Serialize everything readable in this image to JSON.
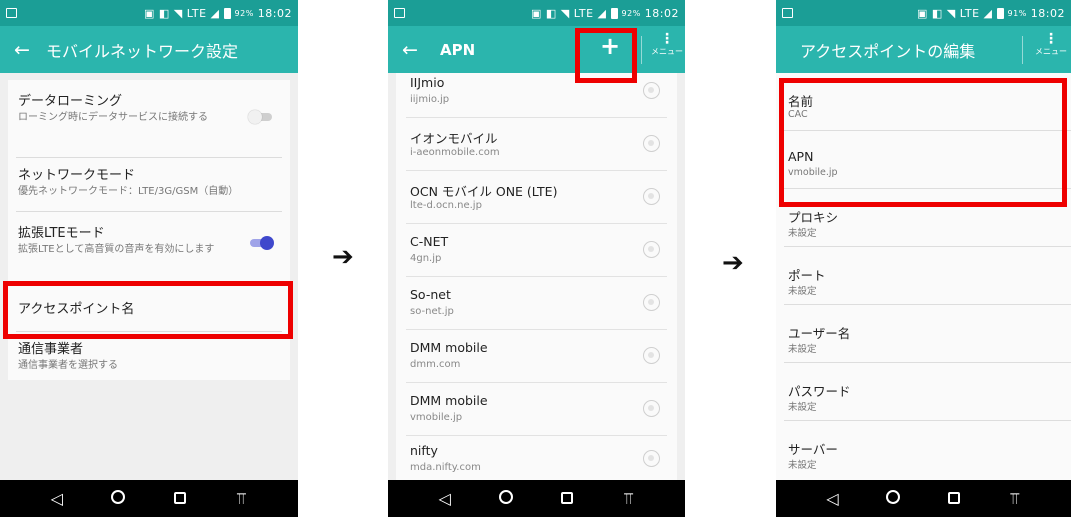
{
  "statusbar": {
    "screen1": {
      "battery": "92%",
      "time": "18:02"
    },
    "screen2": {
      "battery": "92%",
      "time": "18:02"
    },
    "screen3": {
      "battery": "91%",
      "time": "18:02"
    }
  },
  "screen1": {
    "title": "モバイルネットワーク設定",
    "items": [
      {
        "title": "データローミング",
        "summary": "ローミング時にデータサービスに接続する",
        "toggle": "off"
      },
      {
        "title": "ネットワークモード",
        "summary": "優先ネットワークモード：LTE/3G/GSM（自動）"
      },
      {
        "title": "拡張LTEモード",
        "summary": "拡張LTEとして高音質の音声を有効にします",
        "toggle": "on"
      },
      {
        "title": "アクセスポイント名",
        "summary": ""
      },
      {
        "title": "通信事業者",
        "summary": "通信事業者を選択する"
      }
    ]
  },
  "screen2": {
    "title": "APN",
    "menu_label": "メニュー",
    "apns": [
      {
        "name": "IIJmio",
        "apn": "iijmio.jp"
      },
      {
        "name": "イオンモバイル",
        "apn": "i-aeonmobile.com"
      },
      {
        "name": "OCN モバイル ONE (LTE)",
        "apn": "lte-d.ocn.ne.jp"
      },
      {
        "name": "C-NET",
        "apn": "4gn.jp"
      },
      {
        "name": "So-net",
        "apn": "so-net.jp"
      },
      {
        "name": "DMM mobile",
        "apn": "dmm.com"
      },
      {
        "name": "DMM mobile",
        "apn": "vmobile.jp"
      },
      {
        "name": "nifty",
        "apn": "mda.nifty.com"
      }
    ]
  },
  "screen3": {
    "title": "アクセスポイントの編集",
    "menu_label": "メニュー",
    "fields": [
      {
        "name": "名前",
        "value": "CAC"
      },
      {
        "name": "APN",
        "value": "vmobile.jp"
      },
      {
        "name": "プロキシ",
        "value": "未設定"
      },
      {
        "name": "ポート",
        "value": "未設定"
      },
      {
        "name": "ユーザー名",
        "value": "未設定"
      },
      {
        "name": "パスワード",
        "value": "未設定"
      },
      {
        "name": "サーバー",
        "value": "未設定"
      }
    ]
  },
  "icons": {
    "back": "arrow-left-icon",
    "add": "plus-icon",
    "menu": "overflow-menu-icon",
    "flow_arrow": "right-arrow-icon",
    "nav": [
      "back-triangle-icon",
      "home-circle-icon",
      "recents-square-icon",
      "notification-pull-icon"
    ]
  },
  "colors": {
    "statusbar": "#1b9e96",
    "appbar": "#2bb5ad",
    "highlight": "#ee0000",
    "toggle_on": "#3f48cc"
  }
}
